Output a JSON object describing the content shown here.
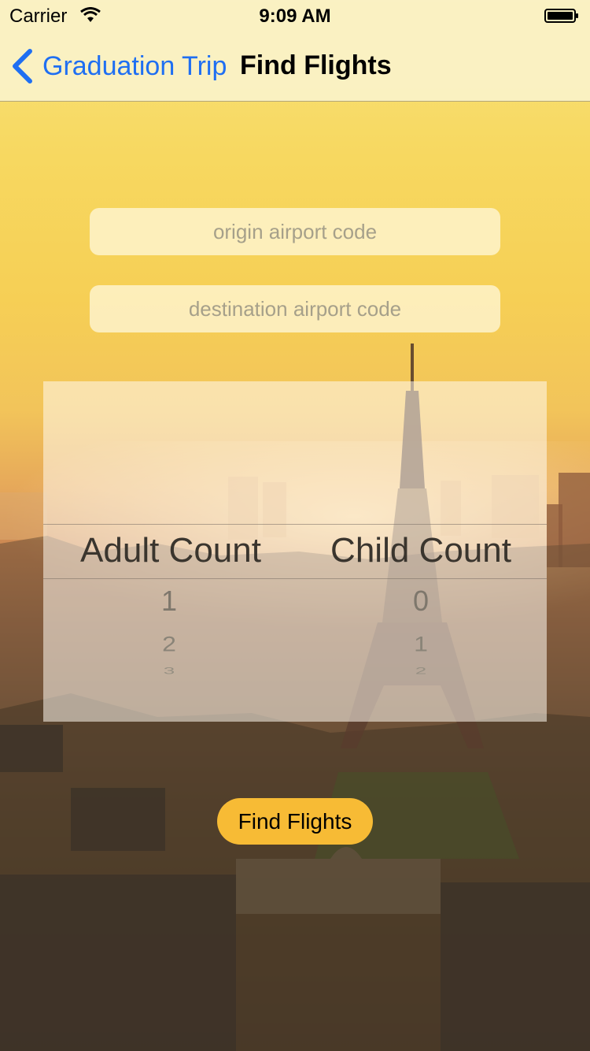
{
  "status_bar": {
    "carrier": "Carrier",
    "time": "9:09 AM",
    "icons": [
      "wifi-icon",
      "battery-icon"
    ]
  },
  "nav": {
    "back_label": "Graduation Trip",
    "back_icon": "chevron-left-icon",
    "title": "Find Flights",
    "accent_color": "#1f6ff2"
  },
  "form": {
    "origin": {
      "value": "",
      "placeholder": "origin airport code"
    },
    "destination": {
      "value": "",
      "placeholder": "destination airport code"
    }
  },
  "picker": {
    "adult": {
      "selected": "Adult Count",
      "options": [
        "1",
        "2",
        "3"
      ]
    },
    "child": {
      "selected": "Child Count",
      "options": [
        "0",
        "1",
        "2"
      ]
    }
  },
  "actions": {
    "find_label": "Find Flights",
    "button_color": "#f7bb35"
  },
  "background": {
    "description_icon": "paris-skyline-background"
  }
}
